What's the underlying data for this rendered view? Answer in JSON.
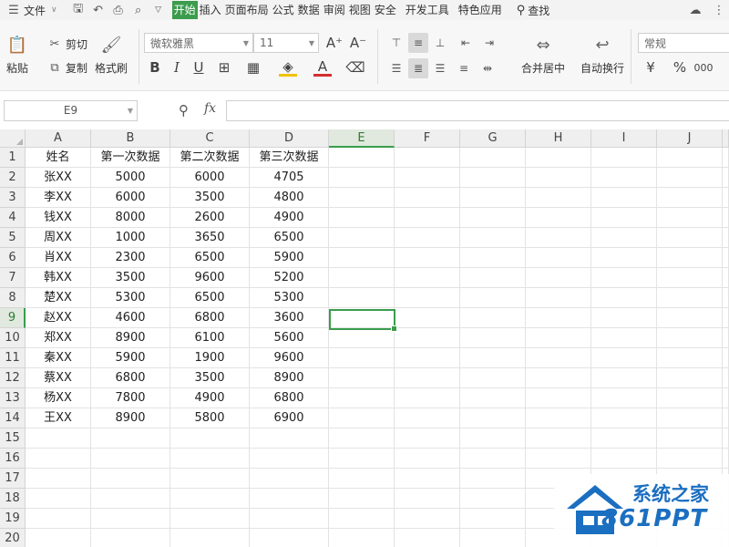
{
  "menubar": {
    "file_label": "文件",
    "tabs": [
      "开始",
      "插入",
      "页面布局",
      "公式",
      "数据",
      "审阅",
      "视图",
      "安全",
      "开发工具",
      "特色应用"
    ],
    "active_tab": "开始",
    "search_label": "查找"
  },
  "ribbon": {
    "paste_label": "粘贴",
    "cut_label": "剪切",
    "copy_label": "复制",
    "format_painter_label": "格式刷",
    "font_name": "微软雅黑",
    "font_size": "11",
    "merge_center_label": "合并居中",
    "wrap_text_label": "自动换行",
    "number_format": "常规",
    "bold": "B",
    "italic": "I",
    "underline": "U",
    "font_color_glyph": "A",
    "grow_font": "A⁺",
    "shrink_font": "A⁻"
  },
  "formula_bar": {
    "name_box": "E9",
    "fx_label": "fx",
    "formula": ""
  },
  "sheet": {
    "columns": [
      "A",
      "B",
      "C",
      "D",
      "E",
      "F",
      "G",
      "H",
      "I",
      "J"
    ],
    "selected_column": "E",
    "selected_row": 9,
    "row_numbers": [
      "1",
      "2",
      "3",
      "4",
      "5",
      "6",
      "7",
      "8",
      "9",
      "10",
      "11",
      "12",
      "13",
      "14",
      "15",
      "16",
      "17",
      "18",
      "19",
      "20"
    ],
    "header_row": [
      "姓名",
      "第一次数据",
      "第二次数据",
      "第三次数据"
    ],
    "rows": [
      [
        "张XX",
        "5000",
        "6000",
        "4705"
      ],
      [
        "李XX",
        "6000",
        "3500",
        "4800"
      ],
      [
        "钱XX",
        "8000",
        "2600",
        "4900"
      ],
      [
        "周XX",
        "1000",
        "3650",
        "6500"
      ],
      [
        "肖XX",
        "2300",
        "6500",
        "5900"
      ],
      [
        "韩XX",
        "3500",
        "9600",
        "5200"
      ],
      [
        "楚XX",
        "5300",
        "6500",
        "5300"
      ],
      [
        "赵XX",
        "4600",
        "6800",
        "3600"
      ],
      [
        "郑XX",
        "8900",
        "6100",
        "5600"
      ],
      [
        "秦XX",
        "5900",
        "1900",
        "9600"
      ],
      [
        "蔡XX",
        "6800",
        "3500",
        "8900"
      ],
      [
        "杨XX",
        "7800",
        "4900",
        "6800"
      ],
      [
        "王XX",
        "8900",
        "5800",
        "6900"
      ]
    ]
  },
  "watermark": {
    "title": "系统之家",
    "brand": "861PPT"
  },
  "colors": {
    "accent_green": "#3a9c4c",
    "watermark_blue": "#1b6fc1"
  }
}
